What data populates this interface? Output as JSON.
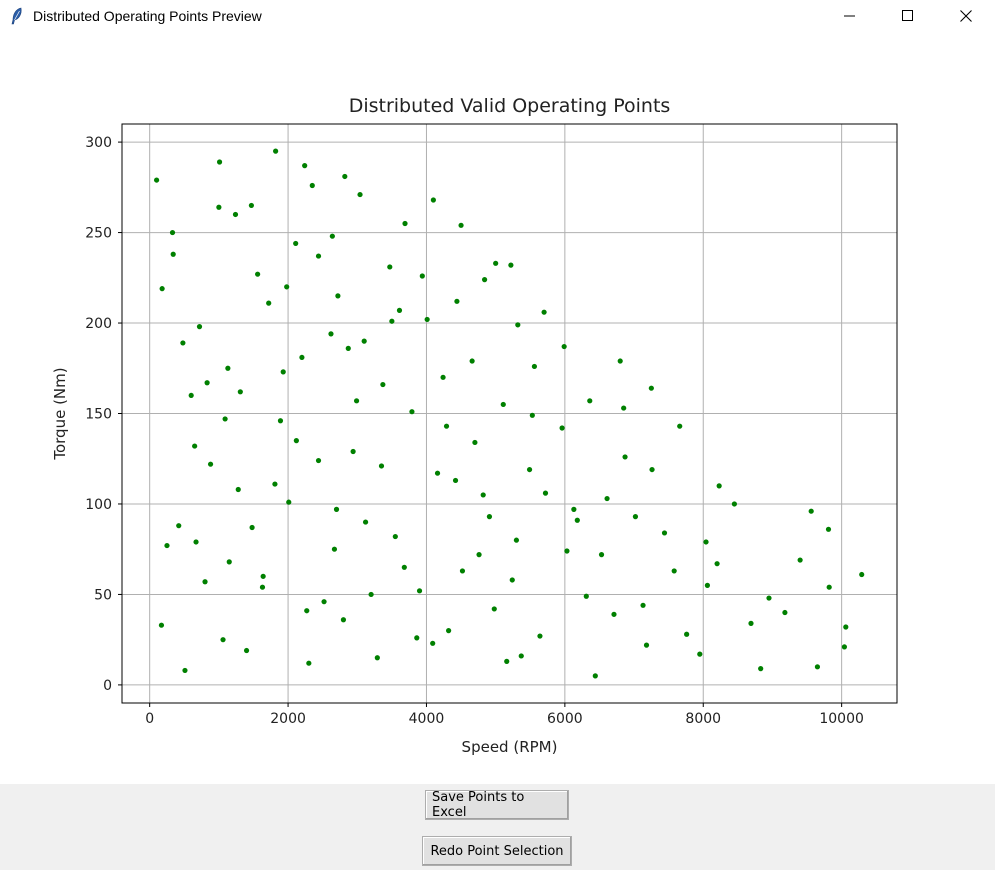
{
  "window": {
    "title": "Distributed Operating Points Preview",
    "app_icon": "feather-icon",
    "controls": [
      "minimize-icon",
      "maximize-icon",
      "close-icon"
    ]
  },
  "buttons": {
    "save_label": "Save Points to Excel",
    "redo_label": "Redo Point Selection"
  },
  "chart_data": {
    "type": "scatter",
    "title": "Distributed Valid Operating Points",
    "xlabel": "Speed (RPM)",
    "ylabel": "Torque (Nm)",
    "xlim": [
      -400,
      10800
    ],
    "ylim": [
      -10,
      310
    ],
    "xticks": [
      0,
      2000,
      4000,
      6000,
      8000,
      10000
    ],
    "xtick_labels": [
      "0",
      "2000",
      "4000",
      "6000",
      "8000",
      "10000"
    ],
    "yticks": [
      0,
      50,
      100,
      150,
      200,
      250,
      300
    ],
    "ytick_labels": [
      "0",
      "50",
      "100",
      "150",
      "200",
      "250",
      "300"
    ],
    "grid": true,
    "marker_color": "#008000",
    "points": [
      [
        100,
        279
      ],
      [
        180,
        219
      ],
      [
        330,
        250
      ],
      [
        340,
        238
      ],
      [
        250,
        77
      ],
      [
        420,
        88
      ],
      [
        480,
        189
      ],
      [
        170,
        33
      ],
      [
        510,
        8
      ],
      [
        600,
        160
      ],
      [
        650,
        132
      ],
      [
        670,
        79
      ],
      [
        720,
        198
      ],
      [
        800,
        57
      ],
      [
        830,
        167
      ],
      [
        880,
        122
      ],
      [
        1000,
        264
      ],
      [
        1010,
        289
      ],
      [
        1060,
        25
      ],
      [
        1090,
        147
      ],
      [
        1130,
        175
      ],
      [
        1150,
        68
      ],
      [
        1240,
        260
      ],
      [
        1280,
        108
      ],
      [
        1310,
        162
      ],
      [
        1400,
        19
      ],
      [
        1470,
        265
      ],
      [
        1480,
        87
      ],
      [
        1560,
        227
      ],
      [
        1630,
        54
      ],
      [
        1640,
        60
      ],
      [
        1720,
        211
      ],
      [
        1810,
        111
      ],
      [
        1820,
        295
      ],
      [
        1890,
        146
      ],
      [
        1930,
        173
      ],
      [
        1980,
        220
      ],
      [
        2010,
        101
      ],
      [
        2110,
        244
      ],
      [
        2120,
        135
      ],
      [
        2200,
        181
      ],
      [
        2240,
        287
      ],
      [
        2270,
        41
      ],
      [
        2300,
        12
      ],
      [
        2350,
        276
      ],
      [
        2440,
        237
      ],
      [
        2440,
        124
      ],
      [
        2520,
        46
      ],
      [
        2620,
        194
      ],
      [
        2640,
        248
      ],
      [
        2670,
        75
      ],
      [
        2700,
        97
      ],
      [
        2720,
        215
      ],
      [
        2800,
        36
      ],
      [
        2820,
        281
      ],
      [
        2870,
        186
      ],
      [
        2940,
        129
      ],
      [
        2990,
        157
      ],
      [
        3040,
        271
      ],
      [
        3100,
        190
      ],
      [
        3120,
        90
      ],
      [
        3200,
        50
      ],
      [
        3290,
        15
      ],
      [
        3350,
        121
      ],
      [
        3370,
        166
      ],
      [
        3470,
        231
      ],
      [
        3500,
        201
      ],
      [
        3550,
        82
      ],
      [
        3610,
        207
      ],
      [
        3680,
        65
      ],
      [
        3690,
        255
      ],
      [
        3790,
        151
      ],
      [
        3860,
        26
      ],
      [
        3900,
        52
      ],
      [
        3940,
        226
      ],
      [
        4010,
        202
      ],
      [
        4090,
        23
      ],
      [
        4100,
        268
      ],
      [
        4160,
        117
      ],
      [
        4240,
        170
      ],
      [
        4290,
        143
      ],
      [
        4320,
        30
      ],
      [
        4420,
        113
      ],
      [
        4440,
        212
      ],
      [
        4500,
        254
      ],
      [
        4520,
        63
      ],
      [
        4660,
        179
      ],
      [
        4700,
        134
      ],
      [
        4760,
        72
      ],
      [
        4820,
        105
      ],
      [
        4840,
        224
      ],
      [
        4910,
        93
      ],
      [
        4980,
        42
      ],
      [
        5000,
        233
      ],
      [
        5110,
        155
      ],
      [
        5160,
        13
      ],
      [
        5220,
        232
      ],
      [
        5240,
        58
      ],
      [
        5300,
        80
      ],
      [
        5320,
        199
      ],
      [
        5370,
        16
      ],
      [
        5490,
        119
      ],
      [
        5530,
        149
      ],
      [
        5560,
        176
      ],
      [
        5640,
        27
      ],
      [
        5700,
        206
      ],
      [
        5720,
        106
      ],
      [
        5960,
        142
      ],
      [
        5990,
        187
      ],
      [
        6030,
        74
      ],
      [
        6130,
        97
      ],
      [
        6180,
        91
      ],
      [
        6310,
        49
      ],
      [
        6360,
        157
      ],
      [
        6440,
        5
      ],
      [
        6530,
        72
      ],
      [
        6610,
        103
      ],
      [
        6710,
        39
      ],
      [
        6800,
        179
      ],
      [
        6850,
        153
      ],
      [
        6870,
        126
      ],
      [
        7020,
        93
      ],
      [
        7130,
        44
      ],
      [
        7180,
        22
      ],
      [
        7250,
        164
      ],
      [
        7260,
        119
      ],
      [
        7440,
        84
      ],
      [
        7580,
        63
      ],
      [
        7660,
        143
      ],
      [
        7760,
        28
      ],
      [
        7950,
        17
      ],
      [
        8040,
        79
      ],
      [
        8060,
        55
      ],
      [
        8200,
        67
      ],
      [
        8230,
        110
      ],
      [
        8450,
        100
      ],
      [
        8690,
        34
      ],
      [
        8830,
        9
      ],
      [
        8950,
        48
      ],
      [
        9180,
        40
      ],
      [
        9400,
        69
      ],
      [
        9560,
        96
      ],
      [
        9650,
        10
      ],
      [
        9810,
        86
      ],
      [
        9820,
        54
      ],
      [
        10040,
        21
      ],
      [
        10060,
        32
      ],
      [
        10290,
        61
      ]
    ]
  }
}
